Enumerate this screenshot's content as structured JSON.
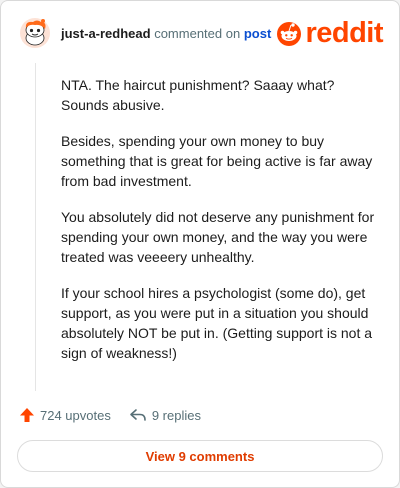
{
  "header": {
    "username": "just-a-redhead",
    "action_text": "commented on",
    "post_link": "post",
    "logo_text": "reddit"
  },
  "colors": {
    "brand": "#ff4500",
    "link": "#0b4fd1",
    "muted": "#576f76"
  },
  "comment": {
    "paragraphs": [
      "NTA. The haircut punishment? Saaay what? Sounds abusive.",
      "Besides, spending your own money to buy something that is great for being active is far away from bad investment.",
      "You absolutely did not deserve any punishment for spending your own money, and the way you were treated was veeeery unhealthy.",
      "If your school hires a psychologist (some do), get support, as you were put in a situation you should absolutely NOT be put in. (Getting support is not a sign of weakness!)"
    ]
  },
  "actions": {
    "upvotes": "724 upvotes",
    "replies": "9 replies",
    "upvote_icon": "upvote-arrow-icon",
    "reply_icon": "reply-arrow-icon"
  },
  "view_button": "View 9 comments"
}
